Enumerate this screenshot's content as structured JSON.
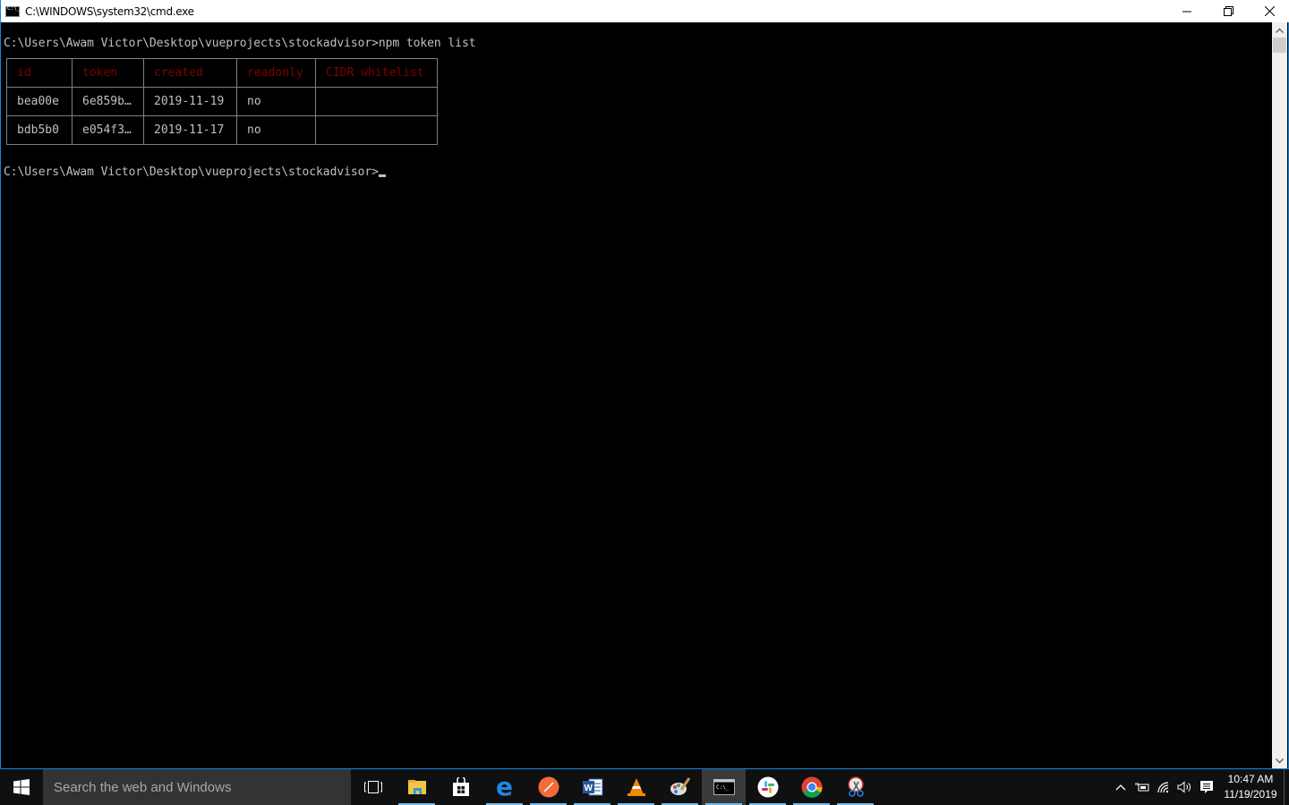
{
  "window": {
    "title": "C:\\WINDOWS\\system32\\cmd.exe",
    "controls": [
      "minimize",
      "restore",
      "close"
    ]
  },
  "console": {
    "lines": [
      "C:\\Users\\Awam Victor\\Desktop\\vueprojects\\stockadvisor>npm token list",
      "C:\\Users\\Awam Victor\\Desktop\\vueprojects\\stockadvisor>"
    ],
    "table": {
      "headers": [
        "id",
        "token",
        "created",
        "readonly",
        "CIDR whitelist"
      ],
      "rows": [
        [
          "bea00e",
          "6e859b…",
          "2019-11-19",
          "no",
          ""
        ],
        [
          "bdb5b0",
          "e054f3…",
          "2019-11-17",
          "no",
          ""
        ]
      ]
    },
    "colors": {
      "text": "#c0c0c0",
      "header": "#800000",
      "background": "#000000",
      "border": "#808080"
    }
  },
  "taskbar": {
    "search_placeholder": "Search the web and Windows",
    "apps": [
      {
        "name": "task-view",
        "running": false
      },
      {
        "name": "file-explorer",
        "running": true
      },
      {
        "name": "store",
        "running": false
      },
      {
        "name": "edge",
        "running": true
      },
      {
        "name": "postman",
        "running": true
      },
      {
        "name": "word",
        "running": true
      },
      {
        "name": "vlc",
        "running": true
      },
      {
        "name": "paint",
        "running": true
      },
      {
        "name": "cmd",
        "running": true,
        "active": true
      },
      {
        "name": "slack",
        "running": true
      },
      {
        "name": "chrome",
        "running": true
      },
      {
        "name": "snipping-tool",
        "running": true
      }
    ],
    "clock": {
      "time": "10:47 AM",
      "date": "11/19/2019"
    }
  }
}
